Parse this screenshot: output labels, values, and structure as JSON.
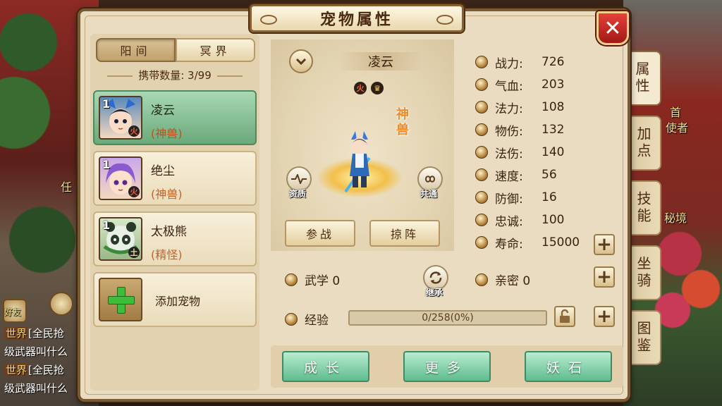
{
  "world": {
    "npc_labels": [
      "任",
      "首",
      "使者",
      "秘境"
    ],
    "chat": [
      {
        "channel": "世界",
        "text": "[全民抢"
      },
      {
        "channel": "",
        "text": "级武器叫什么"
      },
      {
        "channel": "世界",
        "text": "[全民抢"
      },
      {
        "channel": "",
        "text": "级武器叫什么"
      }
    ],
    "friends_label": "好友"
  },
  "panel": {
    "title": "宠物属性",
    "close_label": "✕"
  },
  "realm_tabs": [
    "阳间",
    "冥界"
  ],
  "carry": "携带数量: 3/99",
  "pets": [
    {
      "level": "1",
      "name": "凌云",
      "type": "(神兽)",
      "element": "火",
      "selected": true
    },
    {
      "level": "1",
      "name": "绝尘",
      "type": "(神兽)",
      "element": "火",
      "selected": false
    },
    {
      "level": "1",
      "name": "太极熊",
      "type": "(精怪)",
      "element": "土",
      "selected": false
    }
  ],
  "add_pet_label": "添加宠物",
  "preview": {
    "name": "凌云",
    "divine_tag": "神兽",
    "elem_icon": "火",
    "aptitude_label": "资质",
    "share_label": "共通",
    "join_battle": "参战",
    "formation": "掠阵",
    "inherit_label": "继承"
  },
  "stats": [
    {
      "label": "战力:",
      "value": "726",
      "icon": "power-icon"
    },
    {
      "label": "气血:",
      "value": "203",
      "icon": "hp-icon"
    },
    {
      "label": "法力:",
      "value": "108",
      "icon": "mp-icon"
    },
    {
      "label": "物伤:",
      "value": "132",
      "icon": "physical-icon"
    },
    {
      "label": "法伤:",
      "value": "140",
      "icon": "magic-icon"
    },
    {
      "label": "速度:",
      "value": "56",
      "icon": "speed-icon"
    },
    {
      "label": "防御:",
      "value": "16",
      "icon": "defense-icon"
    },
    {
      "label": "忠诚:",
      "value": "100",
      "icon": "loyalty-icon"
    },
    {
      "label": "寿命:",
      "value": "15000",
      "icon": "lifespan-icon"
    }
  ],
  "martial": "武学 0",
  "intimacy": "亲密 0",
  "exp": {
    "label": "经验",
    "text": "0/258(0%)",
    "fraction": 0
  },
  "bottom_buttons": [
    "成长",
    "更多",
    "妖石"
  ],
  "side_tabs": [
    "属性",
    "加点",
    "技能",
    "坐骑",
    "图鉴"
  ],
  "colors": {
    "accent_green": "#5fbc8e",
    "close_red": "#c42a22",
    "panel_bg": "#e9dcc0"
  }
}
